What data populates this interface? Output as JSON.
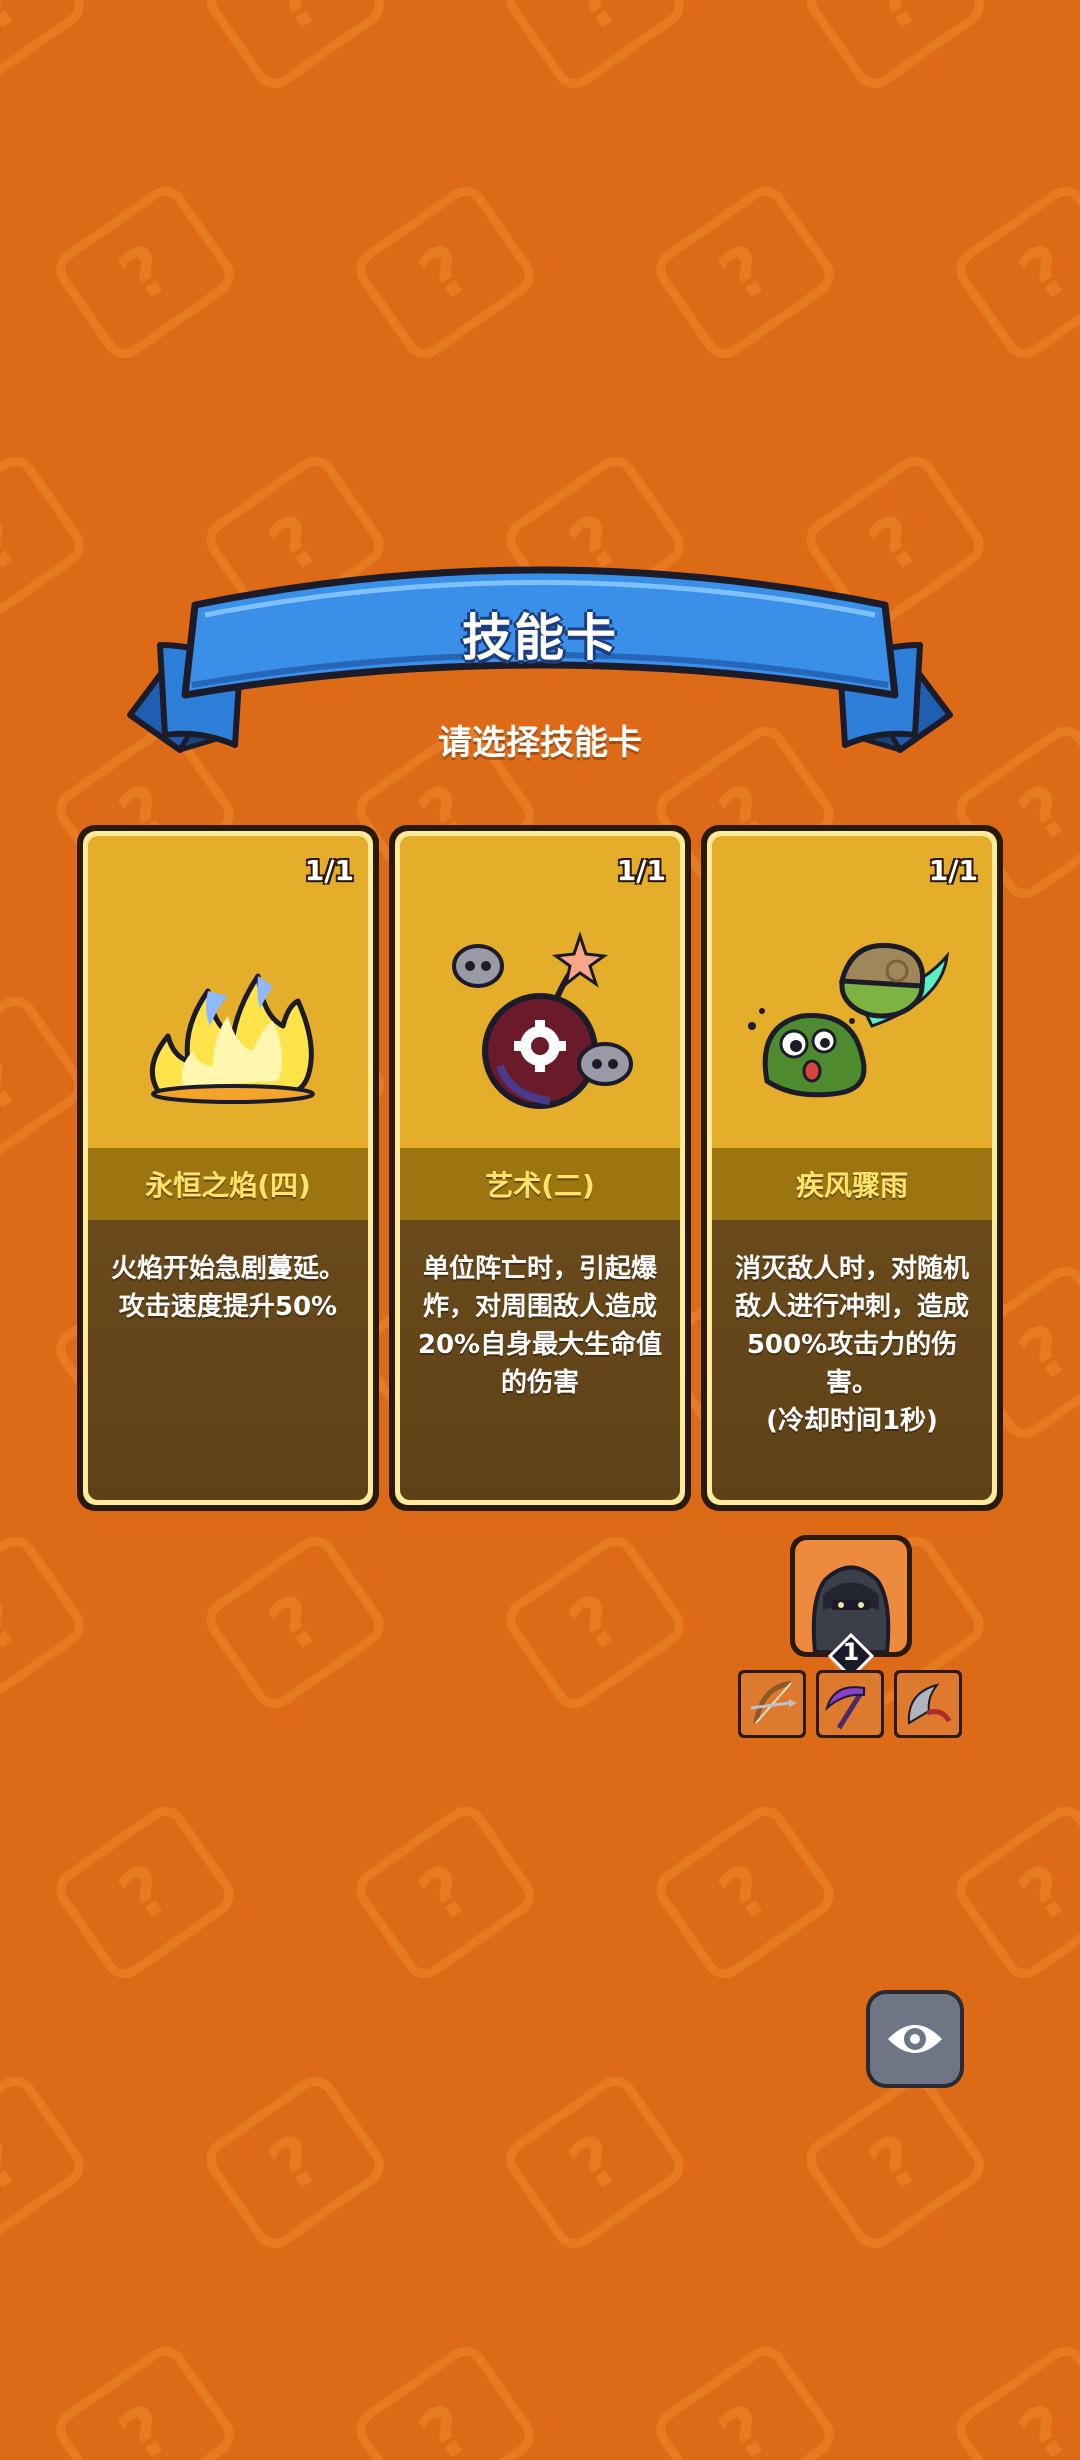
{
  "banner": {
    "title": "技能卡",
    "subtitle": "请选择技能卡"
  },
  "cards": [
    {
      "count": "1/1",
      "name": "永恒之焰(四)",
      "desc_lines": [
        "火焰开始急剧蔓延。",
        "攻击速度提升50%"
      ],
      "icon": "flame-icon"
    },
    {
      "count": "1/1",
      "name": "艺术(二)",
      "desc_lines": [
        "单位阵亡时，引起爆",
        "炸，对周围敌人造成",
        "20%自身最大生命值",
        "的伤害"
      ],
      "icon": "bomb-icon"
    },
    {
      "count": "1/1",
      "name": "疾风骤雨",
      "desc_lines": [
        "消灭敌人时，对随机",
        "敌人进行冲刺，造成",
        "500%攻击力的伤害。",
        "(冷却时间1秒)"
      ],
      "icon": "slime-icon"
    }
  ],
  "hero": {
    "level": "1",
    "icon": "ninja-hero-icon",
    "equipment": [
      "bow-icon",
      "scythe-icon",
      "blade-icon"
    ]
  },
  "eye_button": {
    "icon": "eye-icon"
  },
  "colors": {
    "background": "#DC6A17",
    "banner_blue": "#2E7FD9",
    "card_gold": "#E4AD2A",
    "card_name_bar": "#9C7410",
    "card_desc": "#6A4A1C"
  }
}
